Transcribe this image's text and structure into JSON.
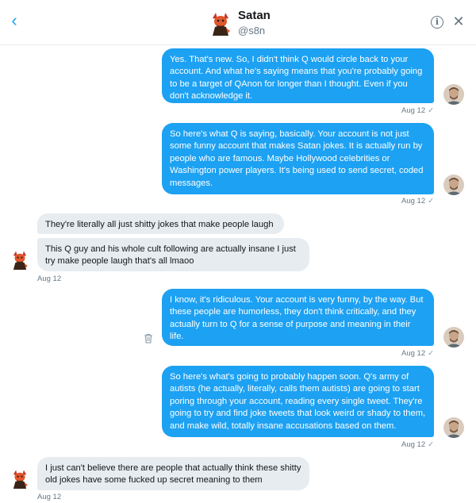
{
  "header": {
    "name": "Satan",
    "handle": "@s8n"
  },
  "messages": [
    {
      "text": "Yes. That's new. So, I didn't think Q would circle back to your account. And what he's saying means that you're probably going to be a target of QAnon for longer than I thought. Even if you don't acknowledge it.",
      "time": "Aug 12"
    },
    {
      "text": "So here's what Q is saying, basically. Your account is not just some funny account that makes Satan jokes. It is actually run by people who are famous. Maybe Hollywood celebrities or Washington power players. It's being used to send secret, coded messages.",
      "time": "Aug 12"
    },
    {
      "text": "They're literally all just shitty jokes that make people laugh"
    },
    {
      "text": "This Q guy and his whole cult following are actually insane I just try make people laugh that's all lmaoo",
      "time": "Aug 12"
    },
    {
      "text": "I know, it's ridiculous. Your account is very funny, by the way. But these people are humorless, they don't think critically, and they actually turn to Q for a sense of purpose and meaning in their life.",
      "time": "Aug 12"
    },
    {
      "text": "So here's what's going to probably happen soon. Q's army of autists (he actually, literally, calls them autists) are going to start poring through your account, reading every single tweet. They're going to try and find joke tweets that look weird or shady to them, and make wild, totally insane accusations based on them.",
      "time": "Aug 12"
    },
    {
      "text": "I just can't believe there are people that actually think these shitty old jokes have some fucked up secret meaning to them",
      "time": "Aug 12"
    }
  ],
  "icons": {
    "back": "chevron-left-icon",
    "info": "info-icon",
    "close": "close-icon",
    "delete": "trash-icon",
    "read": "checkmark-icon"
  },
  "colors": {
    "accent": "#1da1f2",
    "incoming_bubble": "#e6ecf0",
    "muted_text": "#657786"
  },
  "glyphs": {
    "back": "‹",
    "info": "i",
    "close": "✕",
    "check": "✓"
  }
}
